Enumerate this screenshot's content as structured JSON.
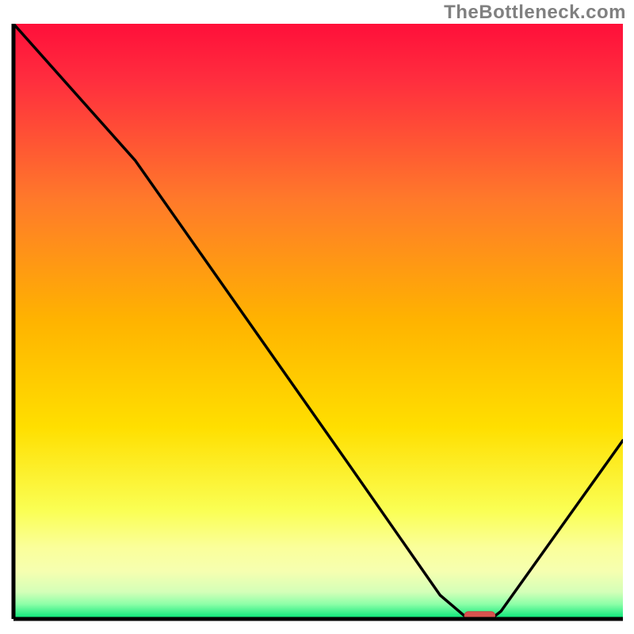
{
  "watermark": "TheBottleneck.com",
  "colors": {
    "gradient_top": "#ff0033",
    "gradient_mid1": "#ff7a2a",
    "gradient_mid2": "#ffd500",
    "gradient_mid3": "#f9ff7a",
    "gradient_band": "#ffff9a",
    "gradient_bottom": "#00e676",
    "curve": "#000000",
    "marker": "#d9534f"
  },
  "chart_data": {
    "type": "line",
    "title": "",
    "xlabel": "",
    "ylabel": "",
    "xlim": [
      0,
      100
    ],
    "ylim": [
      0,
      100
    ],
    "series": [
      {
        "name": "bottleneck-curve",
        "x": [
          0,
          20,
          55,
          70,
          74,
          79,
          80,
          100
        ],
        "values": [
          100,
          77,
          26,
          4,
          0.5,
          0.5,
          1.3,
          30
        ]
      }
    ],
    "annotations": [
      {
        "name": "optimal-marker",
        "x": 76.5,
        "y": 0.5,
        "width_x": 5
      }
    ]
  }
}
